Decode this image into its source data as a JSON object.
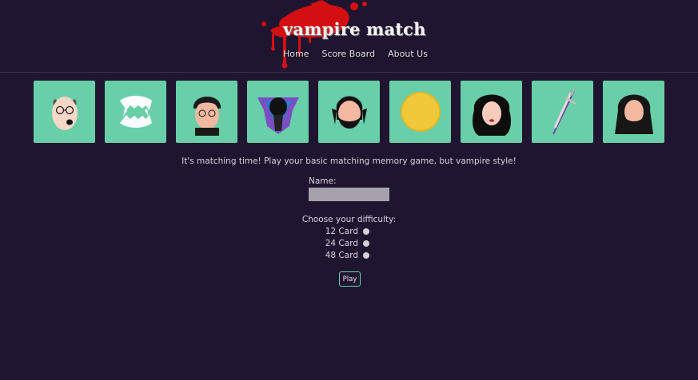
{
  "header": {
    "title": "vampire match",
    "nav": [
      "Home",
      "Score Board",
      "About Us"
    ]
  },
  "cards": [
    "bald-glasses-face-icon",
    "fangs-icon",
    "glasses-man-face-icon",
    "purple-cloak-icon",
    "bearded-man-face-icon",
    "moon-icon",
    "long-hair-woman-face-icon",
    "stake-dagger-icon",
    "long-hair-bearded-man-face-icon"
  ],
  "main": {
    "intro": "It's matching time! Play your basic matching memory game, but vampire style!",
    "name_label": "Name:",
    "name_value": "",
    "difficulty_label": "Choose your difficulty:",
    "options": [
      "12 Card",
      "24 Card",
      "48 Card"
    ],
    "play_label": "Play"
  },
  "colors": {
    "background": "#1f1530",
    "card": "#68cfa8",
    "accent": "#6ad7b0",
    "blood": "#d11010"
  }
}
